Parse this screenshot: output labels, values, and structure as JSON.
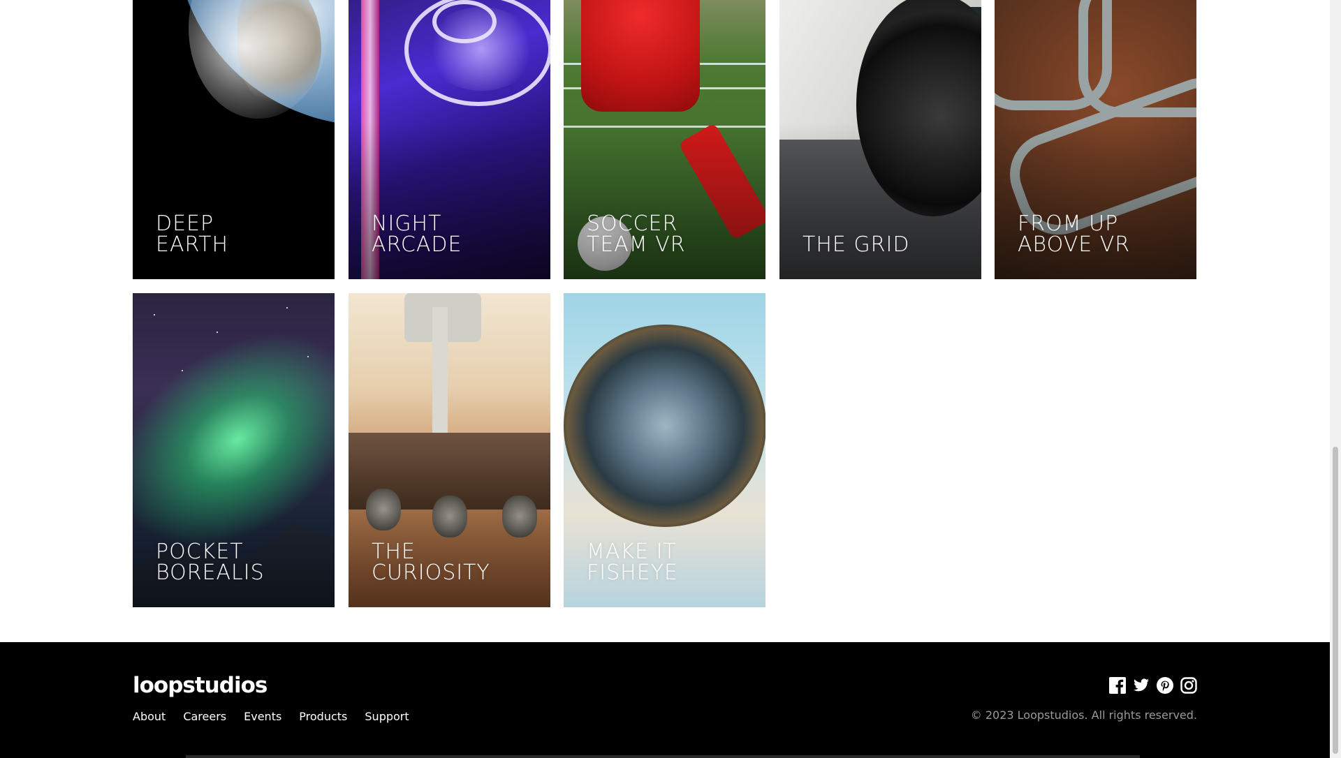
{
  "creations": [
    {
      "id": "deep-earth",
      "label": "Deep\nEarth"
    },
    {
      "id": "night-arcade",
      "label": "Night\nArcade"
    },
    {
      "id": "soccer-team-vr",
      "label": "Soccer\nTeam VR"
    },
    {
      "id": "the-grid",
      "label": "The Grid"
    },
    {
      "id": "from-up-above-vr",
      "label": "From Up\nAbove VR"
    },
    {
      "id": "pocket-borealis",
      "label": "Pocket\nBorealis"
    },
    {
      "id": "the-curiosity",
      "label": "The\nCuriosity"
    },
    {
      "id": "make-it-fisheye",
      "label": "Make It\nFisheye"
    }
  ],
  "footer": {
    "logo": "loopstudios",
    "nav": [
      "About",
      "Careers",
      "Events",
      "Products",
      "Support"
    ],
    "social_icons": [
      "facebook-icon",
      "twitter-icon",
      "pinterest-icon",
      "instagram-icon"
    ],
    "copyright": "© 2023 Loopstudios. All rights reserved."
  },
  "colors": {
    "footer_background": "#000000",
    "card_text": "#ffffff",
    "copyright_text": "#9a9a9a"
  }
}
